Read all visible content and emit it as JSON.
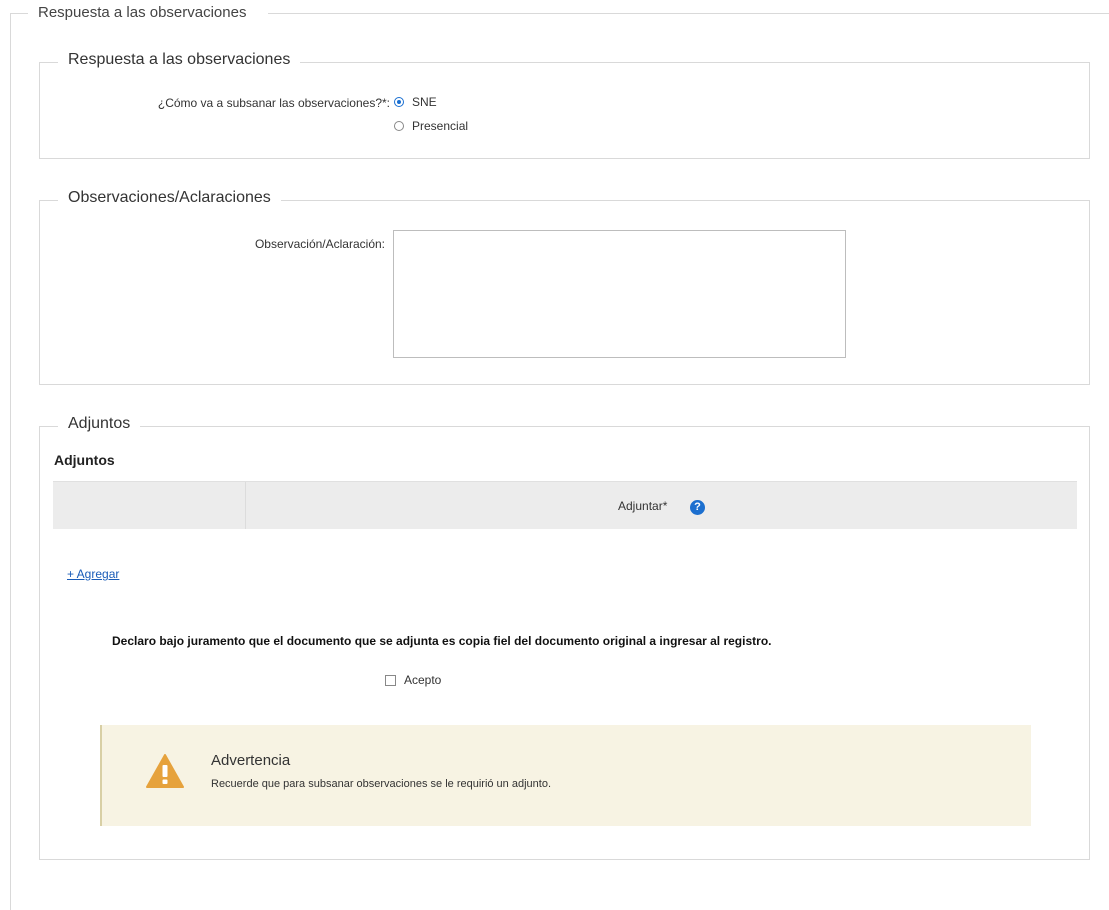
{
  "outer": {
    "legend": "Respuesta a las observaciones"
  },
  "respuesta": {
    "legend": "Respuesta a las observaciones",
    "question_label": "¿Cómo va a subsanar las observaciones?*:",
    "options": [
      {
        "label": "SNE",
        "selected": true
      },
      {
        "label": "Presencial",
        "selected": false
      }
    ]
  },
  "observaciones": {
    "legend": "Observaciones/Aclaraciones",
    "field_label": "Observación/Aclaración:",
    "value": ""
  },
  "adjuntos": {
    "legend": "Adjuntos",
    "subtitle": "Adjuntos",
    "table_header": "Adjuntar*",
    "help_icon": "?",
    "add_link": "+ Agregar",
    "declaration": "Declaro bajo juramento que el documento que se adjunta es copia fiel del documento original a ingresar al registro.",
    "accept_label": "Acepto",
    "accept_checked": false
  },
  "warning": {
    "title": "Advertencia",
    "text": "Recuerde que para subsanar observaciones se le requirió un adjunto.",
    "icon_color": "#e6a23c"
  }
}
